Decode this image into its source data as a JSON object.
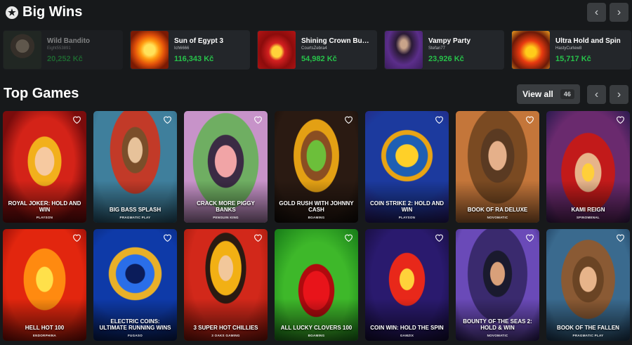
{
  "big_wins": {
    "title": "Big Wins",
    "items": [
      {
        "game": "Wild Bandito",
        "user": "Eight553891",
        "amount": "20,252 Kč",
        "faded": true
      },
      {
        "game": "Sun of Egypt 3",
        "user": "Ich6666",
        "amount": "116,343 Kč"
      },
      {
        "game": "Shining Crown Buy ...",
        "user": "CourtsZebra4",
        "amount": "54,982 Kč"
      },
      {
        "game": "Vampy Party",
        "user": "Stefan77",
        "amount": "23,926 Kč"
      },
      {
        "game": "Ultra Hold and Spin",
        "user": "HastyCurlew8",
        "amount": "15,717 Kč"
      }
    ]
  },
  "top_games": {
    "title": "Top Games",
    "view_all_label": "View all",
    "view_all_count": "46",
    "games": [
      {
        "name": "Royal Joker: Hold and Win",
        "provider": "Playson"
      },
      {
        "name": "Big Bass Splash",
        "provider": "Pragmatic Play"
      },
      {
        "name": "Crack More Piggy Banks",
        "provider": "Penguin King"
      },
      {
        "name": "Gold Rush with Johnny Cash",
        "provider": "BGaming"
      },
      {
        "name": "Coin Strike 2: Hold and Win",
        "provider": "Playson"
      },
      {
        "name": "Book of Ra Deluxe",
        "provider": "Novomatic"
      },
      {
        "name": "Kami Reign",
        "provider": "Spinomenal"
      },
      {
        "name": "Hell Hot 100",
        "provider": "Endorphina"
      },
      {
        "name": "Electric Coins: Ultimate Running Wins",
        "provider": "Fugaso"
      },
      {
        "name": "3 Super Hot Chillies",
        "provider": "3 Oaks Gaming"
      },
      {
        "name": "All Lucky Clovers 100",
        "provider": "BGaming"
      },
      {
        "name": "Coin Win: Hold the Spin",
        "provider": "Gamzix"
      },
      {
        "name": "Bounty of the Seas 2: Hold & Win",
        "provider": "Novomatic"
      },
      {
        "name": "Book of the Fallen",
        "provider": "Pragmatic Play"
      }
    ]
  },
  "icons": {
    "star": "star-icon",
    "chevron_left": "chevron-left-icon",
    "chevron_right": "chevron-right-icon",
    "heart": "heart-icon"
  },
  "colors": {
    "background": "#17191b",
    "card": "#23262a",
    "button": "#3a3d40",
    "win_amount": "#27c24a"
  }
}
